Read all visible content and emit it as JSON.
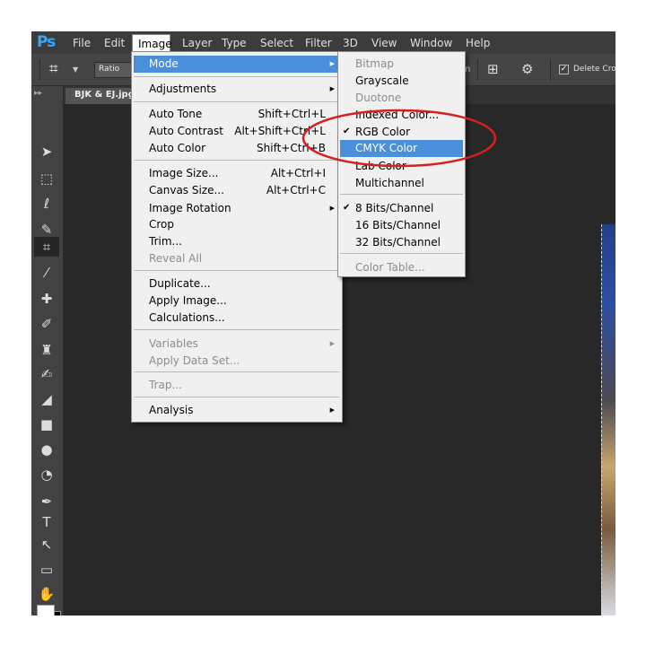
{
  "app": {
    "logo": "Ps",
    "menubar": [
      "File",
      "Edit",
      "Image",
      "Layer",
      "Type",
      "Select",
      "Filter",
      "3D",
      "View",
      "Window",
      "Help"
    ],
    "active_menu": "Image"
  },
  "options_bar": {
    "ratio_label": "Ratio",
    "partial_text": "n",
    "delete_label": "Delete Crop"
  },
  "document": {
    "tab_title": "BJK & EJ.jpg"
  },
  "image_menu": {
    "items": [
      {
        "label": "Mode",
        "shortcut": "",
        "submenu": true,
        "highlighted": true,
        "disabled": false
      },
      {
        "label": "Adjustments",
        "shortcut": "",
        "submenu": true,
        "highlighted": false,
        "disabled": false
      },
      {
        "label": "Auto Tone",
        "shortcut": "Shift+Ctrl+L",
        "submenu": false,
        "highlighted": false,
        "disabled": false
      },
      {
        "label": "Auto Contrast",
        "shortcut": "Alt+Shift+Ctrl+L",
        "submenu": false,
        "highlighted": false,
        "disabled": false
      },
      {
        "label": "Auto Color",
        "shortcut": "Shift+Ctrl+B",
        "submenu": false,
        "highlighted": false,
        "disabled": false
      },
      {
        "label": "Image Size...",
        "shortcut": "Alt+Ctrl+I",
        "submenu": false,
        "highlighted": false,
        "disabled": false
      },
      {
        "label": "Canvas Size...",
        "shortcut": "Alt+Ctrl+C",
        "submenu": false,
        "highlighted": false,
        "disabled": false
      },
      {
        "label": "Image Rotation",
        "shortcut": "",
        "submenu": true,
        "highlighted": false,
        "disabled": false
      },
      {
        "label": "Crop",
        "shortcut": "",
        "submenu": false,
        "highlighted": false,
        "disabled": false
      },
      {
        "label": "Trim...",
        "shortcut": "",
        "submenu": false,
        "highlighted": false,
        "disabled": false
      },
      {
        "label": "Reveal All",
        "shortcut": "",
        "submenu": false,
        "highlighted": false,
        "disabled": true
      },
      {
        "label": "Duplicate...",
        "shortcut": "",
        "submenu": false,
        "highlighted": false,
        "disabled": false
      },
      {
        "label": "Apply Image...",
        "shortcut": "",
        "submenu": false,
        "highlighted": false,
        "disabled": false
      },
      {
        "label": "Calculations...",
        "shortcut": "",
        "submenu": false,
        "highlighted": false,
        "disabled": false
      },
      {
        "label": "Variables",
        "shortcut": "",
        "submenu": true,
        "highlighted": false,
        "disabled": true
      },
      {
        "label": "Apply Data Set...",
        "shortcut": "",
        "submenu": false,
        "highlighted": false,
        "disabled": true
      },
      {
        "label": "Trap...",
        "shortcut": "",
        "submenu": false,
        "highlighted": false,
        "disabled": true
      },
      {
        "label": "Analysis",
        "shortcut": "",
        "submenu": true,
        "highlighted": false,
        "disabled": false
      }
    ]
  },
  "mode_menu": {
    "items": [
      {
        "label": "Bitmap",
        "checked": false,
        "highlighted": false,
        "disabled": true
      },
      {
        "label": "Grayscale",
        "checked": false,
        "highlighted": false,
        "disabled": false
      },
      {
        "label": "Duotone",
        "checked": false,
        "highlighted": false,
        "disabled": true
      },
      {
        "label": "Indexed Color...",
        "checked": false,
        "highlighted": false,
        "disabled": false
      },
      {
        "label": "RGB Color",
        "checked": true,
        "highlighted": false,
        "disabled": false
      },
      {
        "label": "CMYK Color",
        "checked": false,
        "highlighted": true,
        "disabled": false
      },
      {
        "label": "Lab Color",
        "checked": false,
        "highlighted": false,
        "disabled": false
      },
      {
        "label": "Multichannel",
        "checked": false,
        "highlighted": false,
        "disabled": false
      },
      {
        "label": "8 Bits/Channel",
        "checked": true,
        "highlighted": false,
        "disabled": false
      },
      {
        "label": "16 Bits/Channel",
        "checked": false,
        "highlighted": false,
        "disabled": false
      },
      {
        "label": "32 Bits/Channel",
        "checked": false,
        "highlighted": false,
        "disabled": false
      },
      {
        "label": "Color Table...",
        "checked": false,
        "highlighted": false,
        "disabled": true
      }
    ]
  },
  "colors": {
    "menu_highlight": "#4a8fd9",
    "annotation": "#d61f1f",
    "ps_logo": "#31a8ff"
  },
  "tools": [
    "move-tool-icon",
    "marquee-tool-icon",
    "lasso-tool-icon",
    "quick-select-tool-icon",
    "crop-tool-icon",
    "eyedropper-tool-icon",
    "healing-brush-tool-icon",
    "brush-tool-icon",
    "clone-stamp-tool-icon",
    "history-brush-tool-icon",
    "eraser-tool-icon",
    "gradient-tool-icon",
    "blur-tool-icon",
    "dodge-tool-icon",
    "pen-tool-icon",
    "type-tool-icon",
    "path-select-tool-icon",
    "rectangle-tool-icon",
    "hand-tool-icon",
    "zoom-tool-icon"
  ]
}
